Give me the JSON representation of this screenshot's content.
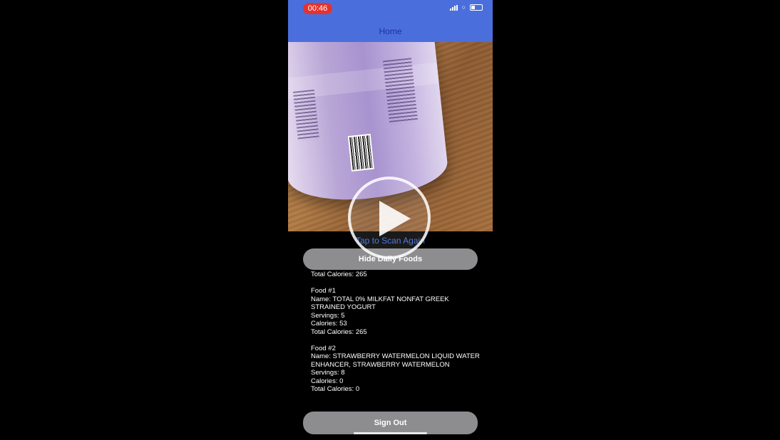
{
  "status_bar": {
    "recording_time": "00:46"
  },
  "navbar": {
    "title": "Home"
  },
  "scan": {
    "link_label": "Tap to Scan Again"
  },
  "buttons": {
    "hide_label": "Hide Daily Foods",
    "sign_out_label": "Sign Out"
  },
  "summary": {
    "total_calories": "Total Calories: 265"
  },
  "foods": [
    {
      "header": "Food #1",
      "name": "Name: TOTAL 0% MILKFAT NONFAT GREEK STRAINED YOGURT",
      "servings": "Servings: 5",
      "calories": "Calories: 53",
      "total": "Total Calories: 265"
    },
    {
      "header": "Food #2",
      "name": "Name: STRAWBERRY WATERMELON LIQUID WATER ENHANCER, STRAWBERRY WATERMELON",
      "servings": "Servings: 8",
      "calories": "Calories: 0",
      "total": "Total Calories: 0"
    }
  ],
  "colors": {
    "navbar": "#4a6fdc",
    "nav_title": "#1c2fa0",
    "recording_pill": "#e5322d",
    "link": "#3a6bd8",
    "button": "#8d8d90"
  },
  "icons": {
    "play": "play-icon",
    "signal": "signal-icon",
    "wifi": "wifi-icon",
    "battery": "battery-icon"
  }
}
